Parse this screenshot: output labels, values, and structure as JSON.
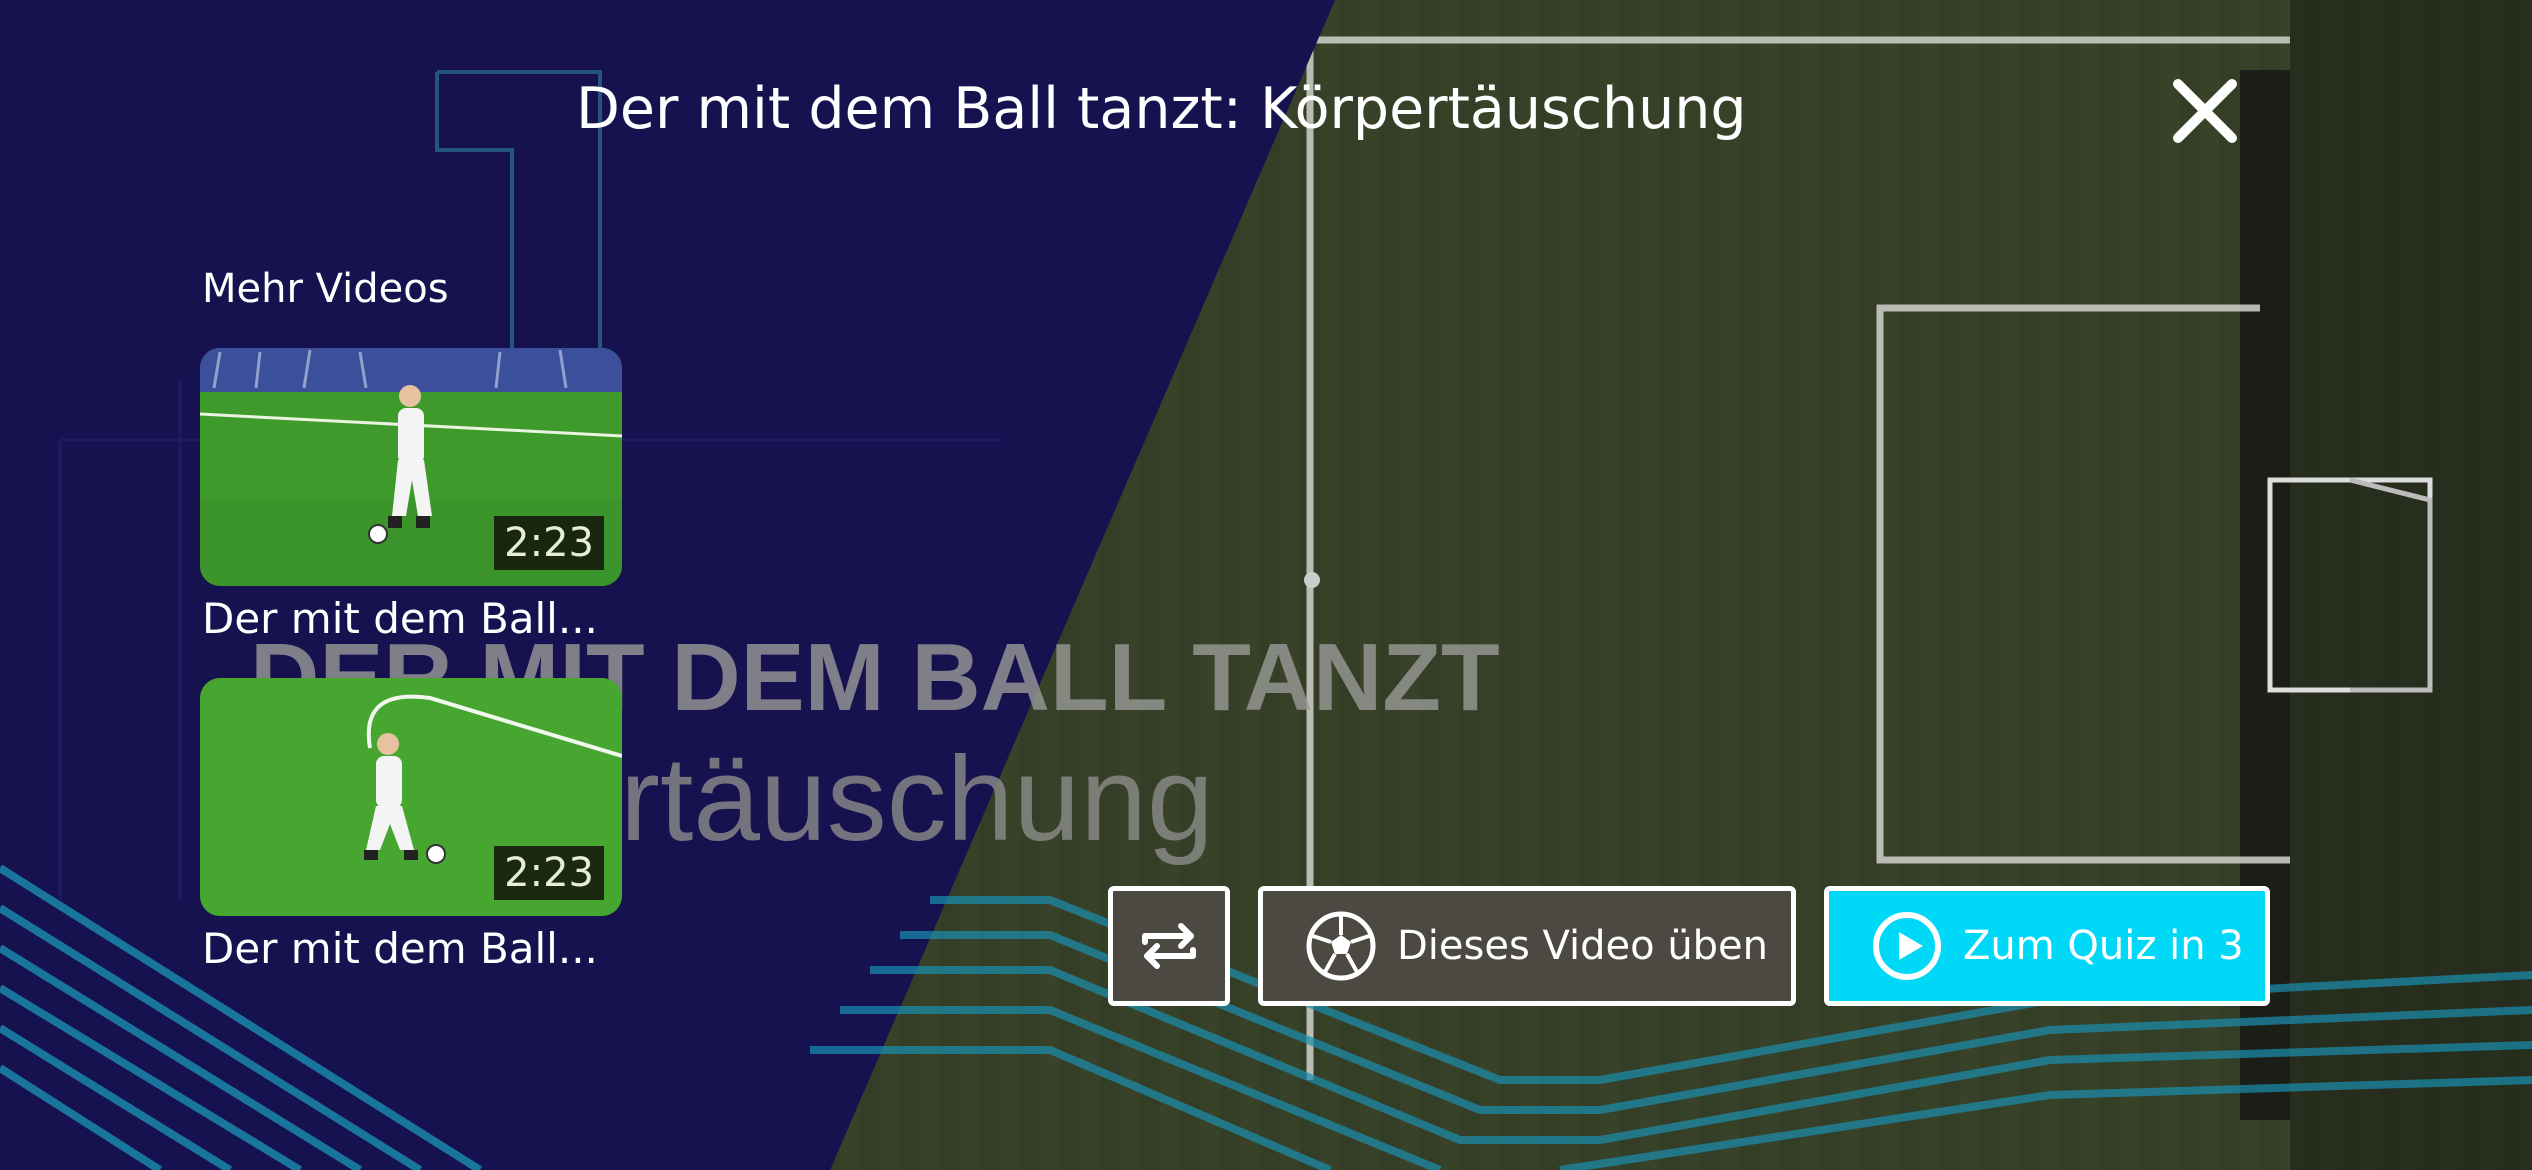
{
  "player": {
    "title": "Der mit dem Ball tanzt: Körpertäuschung",
    "watermark_title": "DER MIT DEM BALL TANZT",
    "watermark_subtitle": "rtäuschung"
  },
  "more_videos": {
    "label": "Mehr Videos",
    "items": [
      {
        "title": "Der mit dem Ball...",
        "duration": "2:23"
      },
      {
        "title": "Der mit dem Ball...",
        "duration": "2:23"
      }
    ]
  },
  "actions": {
    "repeat_icon": "repeat-icon",
    "practice_label": "Dieses Video üben",
    "practice_icon": "soccer-ball-icon",
    "quiz_label": "Zum Quiz in 3",
    "quiz_icon": "play-circle-icon"
  },
  "colors": {
    "background_navy": "#16114f",
    "pitch_green": "#3f4a2c",
    "accent_cyan": "#00d8f8",
    "secondary_button": "#4b4941"
  }
}
